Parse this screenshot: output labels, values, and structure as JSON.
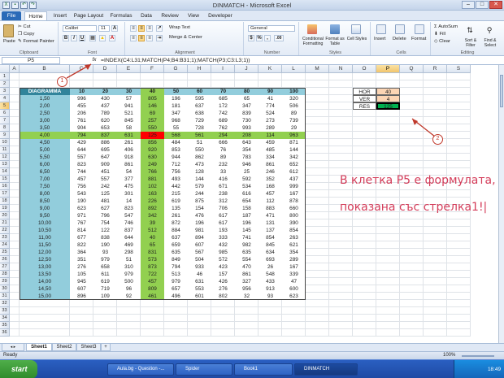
{
  "window": {
    "title": "DINMATCH - Microsoft Excel",
    "controls": [
      "–",
      "□",
      "✕"
    ]
  },
  "tabs": [
    "File",
    "Home",
    "Insert",
    "Page Layout",
    "Formulas",
    "Data",
    "Review",
    "View",
    "Developer"
  ],
  "ribbon": {
    "clipboard": {
      "paste": "Paste",
      "cut": "Cut",
      "copy": "Copy",
      "painter": "Format Painter",
      "label": "Clipboard"
    },
    "font": {
      "name": "Calibri",
      "size": "11",
      "label": "Font",
      "bold": "B",
      "italic": "I",
      "underline": "U"
    },
    "alignment": {
      "wrap": "Wrap Text",
      "merge": "Merge & Center",
      "label": "Alignment"
    },
    "number": {
      "format": "General",
      "pct": "%",
      "comma": ",",
      "dec_up": ".00",
      "label": "Number"
    },
    "styles": {
      "conditional": "Conditional Formatting",
      "table": "Format as Table",
      "cell": "Cell Styles",
      "label": "Styles"
    },
    "cells": {
      "insert": "Insert",
      "delete": "Delete",
      "format": "Format",
      "label": "Cells"
    },
    "editing": {
      "autosum": "AutoSum",
      "fill": "Fill",
      "clear": "Clear",
      "sort": "Sort & Filter",
      "find": "Find & Select",
      "label": "Editing"
    }
  },
  "formula_bar": {
    "name_box": "P5",
    "fx": "fx",
    "formula": "=INDEX(C4:L31;MATCH(P4;B4:B31;1);MATCH(P3;C3:L3;1))"
  },
  "columns": [
    "A",
    "B",
    "C",
    "D",
    "E",
    "F",
    "G",
    "H",
    "I",
    "J",
    "K",
    "L",
    "M",
    "N",
    "O",
    "P",
    "Q",
    "R",
    "S"
  ],
  "table": {
    "header": "DIAGRAMMA",
    "col_headers": [
      "10",
      "20",
      "30",
      "40",
      "50",
      "60",
      "70",
      "80",
      "90",
      "100"
    ],
    "rows": [
      {
        "b": "1,50",
        "v": [
          "996",
          "430",
          "57",
          "805",
          "196",
          "595",
          "685",
          "65",
          "41",
          "320"
        ]
      },
      {
        "b": "2,00",
        "v": [
          "455",
          "437",
          "941",
          "146",
          "181",
          "637",
          "172",
          "347",
          "774",
          "506"
        ]
      },
      {
        "b": "2,50",
        "v": [
          "206",
          "789",
          "521",
          "69",
          "347",
          "638",
          "742",
          "839",
          "524",
          "89"
        ]
      },
      {
        "b": "3,00",
        "v": [
          "761",
          "620",
          "845",
          "257",
          "968",
          "729",
          "689",
          "730",
          "273",
          "739"
        ]
      },
      {
        "b": "3,50",
        "v": [
          "904",
          "653",
          "58",
          "550",
          "55",
          "728",
          "762",
          "993",
          "289",
          "29"
        ]
      },
      {
        "b": "4,00",
        "v": [
          "794",
          "837",
          "631",
          "125",
          "568",
          "561",
          "294",
          "208",
          "114",
          "963"
        ]
      },
      {
        "b": "4,50",
        "v": [
          "429",
          "886",
          "261",
          "856",
          "484",
          "51",
          "666",
          "643",
          "459",
          "871"
        ]
      },
      {
        "b": "5,00",
        "v": [
          "644",
          "695",
          "406",
          "920",
          "853",
          "550",
          "76",
          "354",
          "485",
          "144"
        ]
      },
      {
        "b": "5,50",
        "v": [
          "557",
          "647",
          "918",
          "630",
          "944",
          "862",
          "89",
          "783",
          "334",
          "342"
        ]
      },
      {
        "b": "6,00",
        "v": [
          "823",
          "909",
          "861",
          "249",
          "712",
          "473",
          "232",
          "946",
          "861",
          "652"
        ]
      },
      {
        "b": "6,50",
        "v": [
          "744",
          "451",
          "54",
          "766",
          "756",
          "128",
          "33",
          "25",
          "246",
          "612"
        ]
      },
      {
        "b": "7,00",
        "v": [
          "457",
          "557",
          "377",
          "881",
          "493",
          "144",
          "416",
          "592",
          "352",
          "437"
        ]
      },
      {
        "b": "7,50",
        "v": [
          "756",
          "242",
          "475",
          "102",
          "442",
          "579",
          "671",
          "534",
          "168",
          "999"
        ]
      },
      {
        "b": "8,00",
        "v": [
          "543",
          "125",
          "301",
          "163",
          "215",
          "244",
          "238",
          "616",
          "457",
          "167"
        ]
      },
      {
        "b": "8,50",
        "v": [
          "190",
          "481",
          "14",
          "226",
          "619",
          "875",
          "312",
          "654",
          "112",
          "878"
        ]
      },
      {
        "b": "9,00",
        "v": [
          "623",
          "627",
          "823",
          "892",
          "135",
          "154",
          "706",
          "158",
          "883",
          "660"
        ]
      },
      {
        "b": "9,50",
        "v": [
          "971",
          "796",
          "547",
          "342",
          "261",
          "476",
          "617",
          "187",
          "471",
          "800"
        ]
      },
      {
        "b": "10,00",
        "v": [
          "767",
          "754",
          "746",
          "39",
          "872",
          "196",
          "617",
          "196",
          "131",
          "390"
        ]
      },
      {
        "b": "10,50",
        "v": [
          "814",
          "122",
          "837",
          "512",
          "884",
          "981",
          "193",
          "145",
          "137",
          "854"
        ]
      },
      {
        "b": "11,00",
        "v": [
          "677",
          "838",
          "644",
          "40",
          "637",
          "894",
          "333",
          "741",
          "854",
          "263"
        ]
      },
      {
        "b": "11,50",
        "v": [
          "822",
          "190",
          "469",
          "65",
          "659",
          "607",
          "432",
          "982",
          "845",
          "621"
        ]
      },
      {
        "b": "12,00",
        "v": [
          "364",
          "93",
          "298",
          "831",
          "635",
          "567",
          "985",
          "635",
          "634",
          "354"
        ]
      },
      {
        "b": "12,50",
        "v": [
          "351",
          "979",
          "51",
          "573",
          "849",
          "504",
          "572",
          "554",
          "693",
          "289"
        ]
      },
      {
        "b": "13,00",
        "v": [
          "276",
          "658",
          "310",
          "873",
          "794",
          "933",
          "423",
          "470",
          "26",
          "167"
        ]
      },
      {
        "b": "13,50",
        "v": [
          "105",
          "611",
          "979",
          "722",
          "513",
          "46",
          "157",
          "861",
          "548",
          "339"
        ]
      },
      {
        "b": "14,00",
        "v": [
          "945",
          "619",
          "500",
          "457",
          "979",
          "631",
          "426",
          "327",
          "433",
          "47"
        ]
      },
      {
        "b": "14,50",
        "v": [
          "607",
          "719",
          "96",
          "809",
          "657",
          "553",
          "276",
          "956",
          "913",
          "600"
        ]
      },
      {
        "b": "15,00",
        "v": [
          "896",
          "109",
          "92",
          "461",
          "496",
          "601",
          "802",
          "32",
          "93",
          "623"
        ]
      }
    ]
  },
  "lookup": {
    "hor_label": "HOR",
    "hor_value": "40",
    "ver_label": "VER",
    "ver_value": "4",
    "res_label": "RES",
    "res_value": "125"
  },
  "annotation": {
    "line1": "В  клетка P5 е формулата,",
    "line2": "показана със стрелка1!|",
    "marker1": "1",
    "marker2": "2"
  },
  "sheets": [
    "Sheet1",
    "Sheet2",
    "Sheet3"
  ],
  "status": {
    "ready": "Ready",
    "zoom": "100%"
  },
  "taskbar": {
    "start": "start",
    "items": [
      "Aula.bg - Question -...",
      "Spider",
      "Book1",
      "DINMATCH"
    ],
    "clock": "18:49"
  },
  "colors": {
    "header_blue": "#92cddc",
    "col_green": "#92d050",
    "row_green": "#92d050",
    "red": "#ff0000",
    "accent": "#d43d5a",
    "res_green": "#00b050",
    "lookup_tan": "#fcd5b4"
  }
}
